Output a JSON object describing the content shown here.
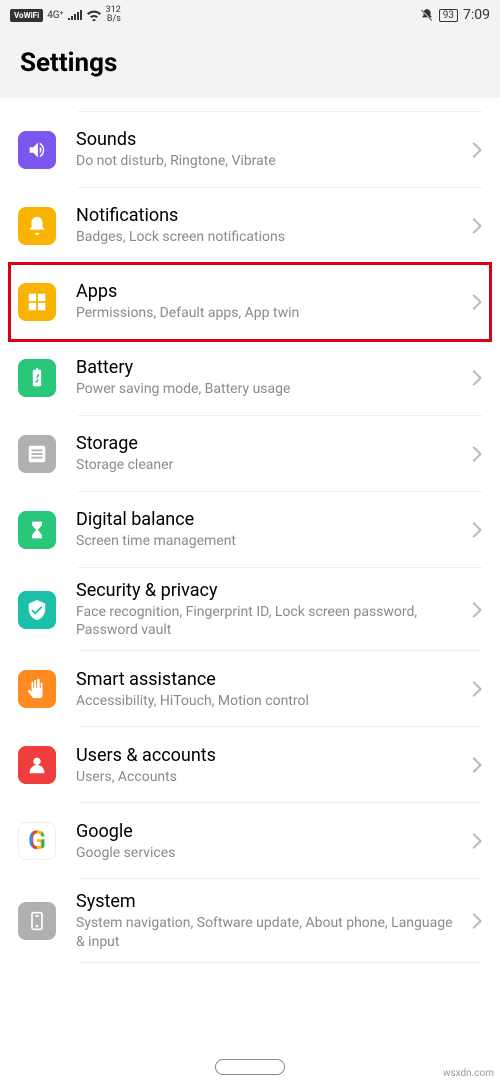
{
  "status": {
    "vowifi": "VoWiFi",
    "signal_label": "4G⁺",
    "speed_top": "312",
    "speed_bot": "B/s",
    "battery": "93",
    "time": "7:09"
  },
  "header": {
    "title": "Settings"
  },
  "items": [
    {
      "title": "Sounds",
      "subtitle": "Do not disturb, Ringtone, Vibrate",
      "color": "#7b57f0",
      "icon": "sound"
    },
    {
      "title": "Notifications",
      "subtitle": "Badges, Lock screen notifications",
      "color": "#f8b400",
      "icon": "bell"
    },
    {
      "title": "Apps",
      "subtitle": "Permissions, Default apps, App twin",
      "color": "#f8b400",
      "icon": "apps"
    },
    {
      "title": "Battery",
      "subtitle": "Power saving mode, Battery usage",
      "color": "#29c77a",
      "icon": "battery"
    },
    {
      "title": "Storage",
      "subtitle": "Storage cleaner",
      "color": "#b0b0b0",
      "icon": "storage"
    },
    {
      "title": "Digital balance",
      "subtitle": "Screen time management",
      "color": "#29c77a",
      "icon": "hourglass"
    },
    {
      "title": "Security & privacy",
      "subtitle": "Face recognition, Fingerprint ID, Lock screen password, Password vault",
      "color": "#1bc0a8",
      "icon": "shield"
    },
    {
      "title": "Smart assistance",
      "subtitle": "Accessibility, HiTouch, Motion control",
      "color": "#ff8a1f",
      "icon": "hand"
    },
    {
      "title": "Users & accounts",
      "subtitle": "Users, Accounts",
      "color": "#ef3e3e",
      "icon": "user"
    },
    {
      "title": "Google",
      "subtitle": "Google services",
      "color": "#ffffff",
      "icon": "google"
    },
    {
      "title": "System",
      "subtitle": "System navigation, Software update, About phone, Language & input",
      "color": "#b0b0b0",
      "icon": "system"
    }
  ],
  "watermark": "wsxdn.com"
}
